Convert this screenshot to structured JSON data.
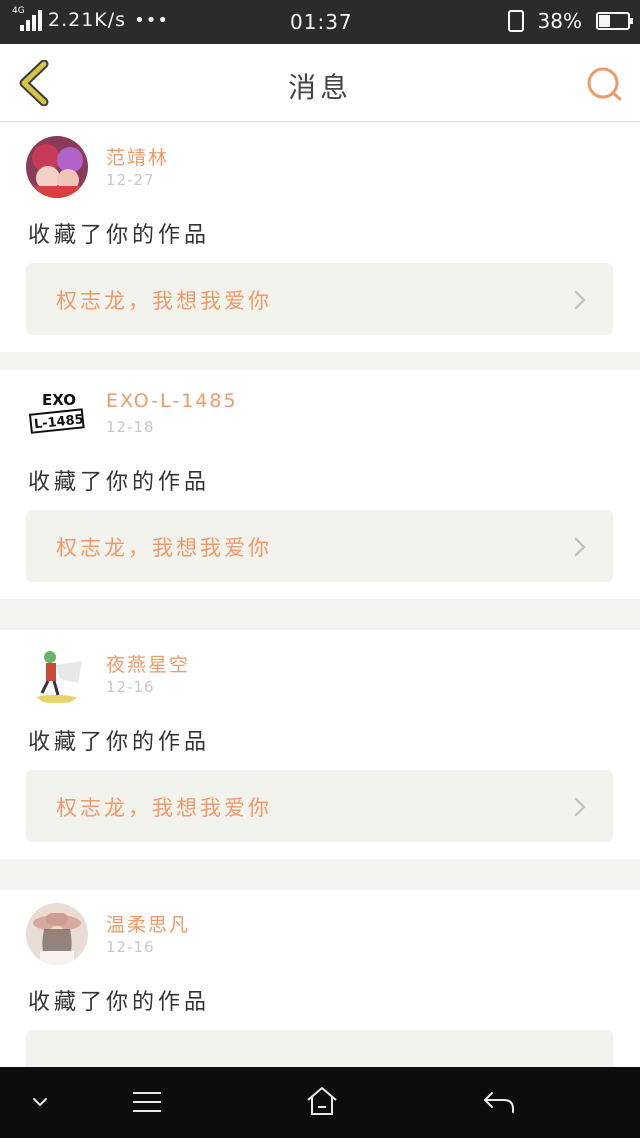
{
  "status_bar": {
    "network": "4G",
    "speed": "2.21K/s",
    "dots": "•••",
    "time": "01:37",
    "battery": "38%",
    "battery_level": 0.38
  },
  "header": {
    "title": "消息",
    "back_icon": "back-chevron-icon",
    "search_icon": "search-icon"
  },
  "notifications": [
    {
      "username": "范靖林",
      "date": "12-27",
      "action": "收藏了你的作品",
      "work_title": "权志龙，我想我爱你",
      "avatar": "anime-avatar"
    },
    {
      "username": "EXO-L-1485",
      "date": "12-18",
      "action": "收藏了你的作品",
      "work_title": "权志龙，我想我爱你",
      "avatar": "exo-logo-avatar",
      "avatar_text_top": "EXO",
      "avatar_text_bottom": "L-1485"
    },
    {
      "username": "夜燕星空",
      "date": "12-16",
      "action": "收藏了你的作品",
      "work_title": "权志龙，我想我爱你",
      "avatar": "cartoon-avatar"
    },
    {
      "username": "温柔思凡",
      "date": "12-16",
      "action": "收藏了你的作品",
      "work_title": "",
      "avatar": "photo-avatar"
    }
  ],
  "bottom_nav": {
    "icons": [
      "collapse-icon",
      "menu-icon",
      "home-icon",
      "back-icon"
    ]
  },
  "colors": {
    "accent": "#ef9a6a",
    "status_bar": "#2b2b2b",
    "nav_bar": "#0d0d0d",
    "back_icon": "#d6c24a"
  }
}
